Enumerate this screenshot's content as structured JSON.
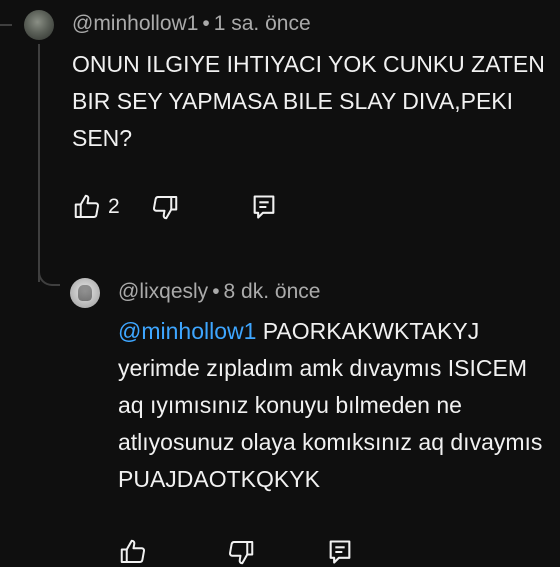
{
  "comment": {
    "author": "@minhollow1",
    "time": "1 sa. önce",
    "text": "ONUN ILGIYE IHTIYACI YOK CUNKU ZATEN BIR SEY YAPMASA BILE SLAY DIVA,PEKI SEN?",
    "like_count": "2",
    "icons": [
      "like-icon",
      "dislike-icon",
      "reply-icon"
    ]
  },
  "reply": {
    "author": "@lixqesly",
    "time": "8 dk. önce",
    "mention": "@minhollow1",
    "text": "PAORKAKWKTAKYJ yerimde zıpladım amk dıvaymıs ISICEM aq ıyımısınız konuyu bılmeden ne atlıyosunuz olaya komıksınız aq dıvaymıs PUAJDAOTKQKYK",
    "icons": [
      "like-icon",
      "dislike-icon",
      "reply-icon"
    ]
  },
  "separator": "•"
}
